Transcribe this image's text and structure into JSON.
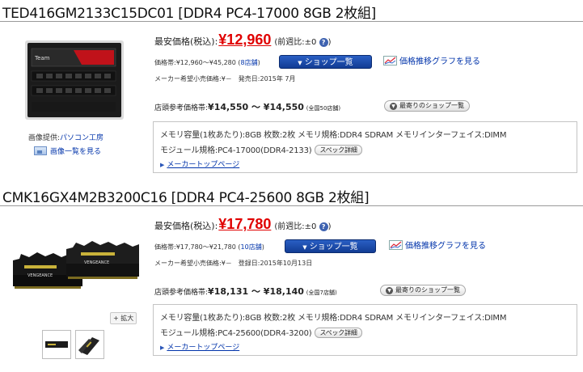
{
  "products": [
    {
      "title": "TED416GM2133C15DC01 [DDR4 PC4-17000 8GB 2枚組]",
      "price_label": "最安価格(税込):",
      "price": "¥12,960",
      "weekly": "(前週比:±0",
      "weekly_close": ")",
      "help": "?",
      "price_range_text": "価格帯:¥12,960～¥45,280 (",
      "price_range_link": "8店舗",
      "price_range_close": ")",
      "maker_price_text": "メーカー希望小売価格:¥－　発売日:2015年 7月",
      "shop_button": "ショップ一覧",
      "graph_link": "価格推移グラフを見る",
      "store_label": "店頭参考価格帯:",
      "store_range": "¥14,550 ～ ¥14,550",
      "store_count": "(全国50店舗)",
      "near_button": "最寄りのショップ一覧",
      "image_credit_label": "画像提供:",
      "image_credit_link": "パソコン工房",
      "image_list_link": "画像一覧を見る",
      "spec_line1": "メモリ容量(1枚あたり):8GB 枚数:2枚 メモリ規格:DDR4 SDRAM メモリインターフェイス:DIMM",
      "spec_line2": "モジュール規格:PC4-17000(DDR4-2133)",
      "spec_button": "スペック詳細",
      "maker_top": "メーカートップページ"
    },
    {
      "title": "CMK16GX4M2B3200C16 [DDR4 PC4-25600 8GB 2枚組]",
      "price_label": "最安価格(税込):",
      "price": "¥17,780",
      "weekly": "(前週比:±0",
      "weekly_close": ")",
      "help": "?",
      "price_range_text": "価格帯:¥17,780～¥21,780 (",
      "price_range_link": "10店舗",
      "price_range_close": ")",
      "maker_price_text": "メーカー希望小売価格:¥－　登録日:2015年10月13日",
      "shop_button": "ショップ一覧",
      "graph_link": "価格推移グラフを見る",
      "store_label": "店頭参考価格帯:",
      "store_range": "¥18,131 ～ ¥18,140",
      "store_count": "(全国7店舗)",
      "near_button": "最寄りのショップ一覧",
      "zoom_label": "+ 拡大",
      "spec_line1": "メモリ容量(1枚あたり):8GB 枚数:2枚 メモリ規格:DDR4 SDRAM メモリインターフェイス:DIMM",
      "spec_line2": "モジュール規格:PC4-25600(DDR4-3200)",
      "spec_button": "スペック詳細",
      "maker_top": "メーカートップページ"
    }
  ],
  "icons": {
    "dropdown": "triangle-down-icon",
    "graph": "line-chart-icon",
    "help": "question-mark-icon",
    "arrow": "right-arrow-icon"
  },
  "colors": {
    "price": "#e00000",
    "link": "#0033aa",
    "button": "#1a4aab"
  }
}
